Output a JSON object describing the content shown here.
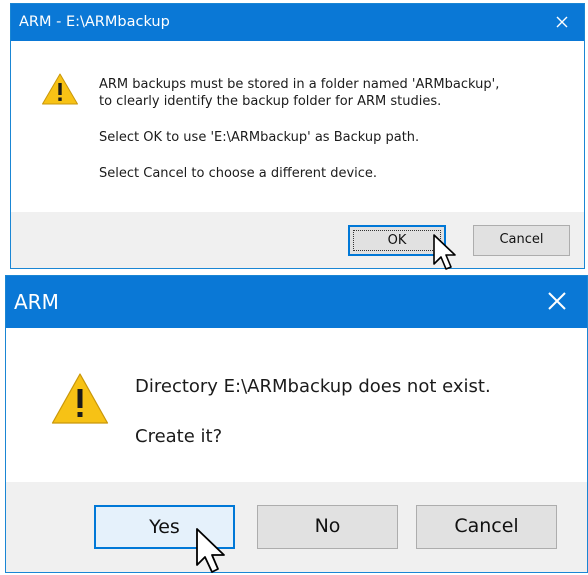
{
  "dialog1": {
    "title": "ARM - E:\\ARMbackup",
    "icon": "warning-icon",
    "message_lines": [
      "ARM backups must be stored in a folder named 'ARMbackup',",
      "to clearly identify the backup folder for ARM studies."
    ],
    "select_ok_text": "Select OK to use 'E:\\ARMbackup' as Backup path.",
    "select_cancel_text": "Select Cancel to choose a different device.",
    "buttons": {
      "ok": "OK",
      "cancel": "Cancel"
    }
  },
  "dialog2": {
    "title": "ARM",
    "icon": "warning-icon",
    "message": "Directory E:\\ARMbackup does not exist.",
    "question": "Create it?",
    "buttons": {
      "yes": "Yes",
      "no": "No",
      "cancel": "Cancel"
    }
  },
  "colors": {
    "titlebar": "#0a78d6",
    "footer": "#f0f0f0",
    "button": "#e1e1e1",
    "default_button_border": "#0078d7",
    "warning_fill": "#f7c215"
  }
}
